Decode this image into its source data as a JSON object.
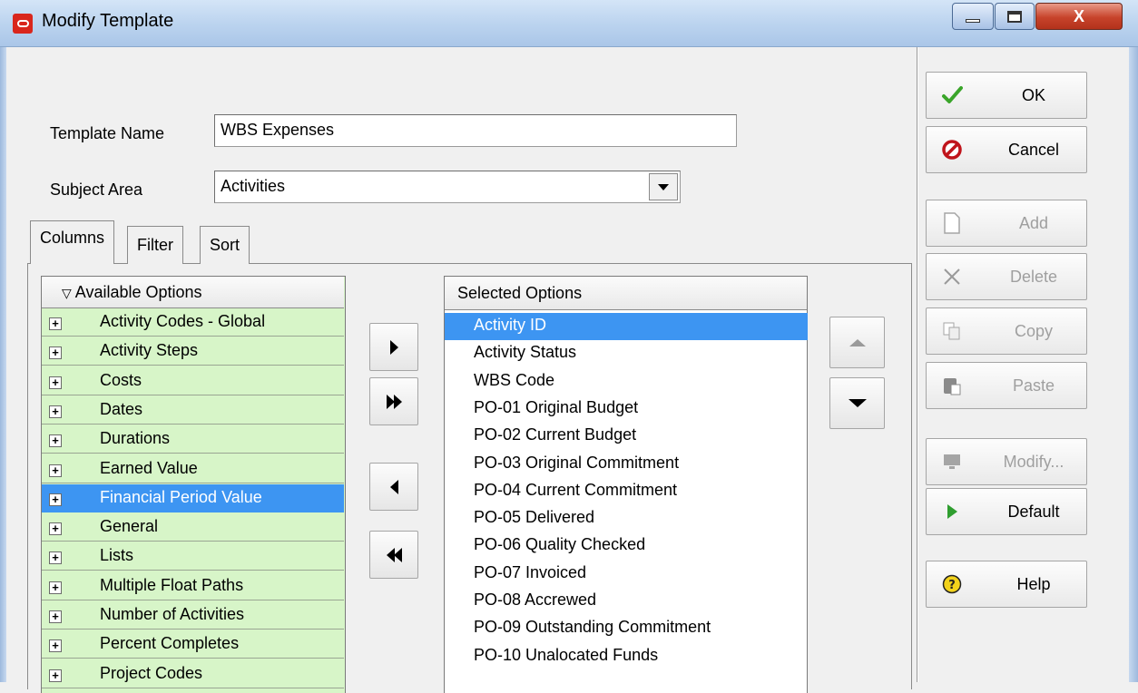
{
  "window": {
    "title": "Modify Template",
    "controls": {
      "close": "X"
    }
  },
  "form": {
    "template_name_label": "Template Name",
    "template_name_value": "WBS Expenses",
    "subject_area_label": "Subject Area",
    "subject_area_value": "Activities"
  },
  "tabs": [
    {
      "label": "Columns",
      "active": true
    },
    {
      "label": "Filter",
      "active": false
    },
    {
      "label": "Sort",
      "active": false
    }
  ],
  "available": {
    "header": "Available Options",
    "header_icon": "sort-down-triangle",
    "expand_glyph": "+",
    "items": [
      {
        "label": "Activity Codes - Global",
        "selected": false
      },
      {
        "label": "Activity Steps",
        "selected": false
      },
      {
        "label": "Costs",
        "selected": false
      },
      {
        "label": "Dates",
        "selected": false
      },
      {
        "label": "Durations",
        "selected": false
      },
      {
        "label": "Earned Value",
        "selected": false
      },
      {
        "label": "Financial Period Value",
        "selected": true
      },
      {
        "label": "General",
        "selected": false
      },
      {
        "label": "Lists",
        "selected": false
      },
      {
        "label": "Multiple Float Paths",
        "selected": false
      },
      {
        "label": "Number of Activities",
        "selected": false
      },
      {
        "label": "Percent Completes",
        "selected": false
      },
      {
        "label": "Project Codes",
        "selected": false
      }
    ]
  },
  "selected": {
    "header": "Selected Options",
    "items": [
      {
        "label": "Activity ID",
        "selected": true
      },
      {
        "label": "Activity Status",
        "selected": false
      },
      {
        "label": "WBS Code",
        "selected": false
      },
      {
        "label": "PO-01 Original Budget",
        "selected": false
      },
      {
        "label": "PO-02 Current Budget",
        "selected": false
      },
      {
        "label": "PO-03 Original Commitment",
        "selected": false
      },
      {
        "label": "PO-04 Current Commitment",
        "selected": false
      },
      {
        "label": "PO-05 Delivered",
        "selected": false
      },
      {
        "label": "PO-06 Quality Checked",
        "selected": false
      },
      {
        "label": "PO-07 Invoiced",
        "selected": false
      },
      {
        "label": "PO-08 Accrewed",
        "selected": false
      },
      {
        "label": "PO-09 Outstanding Commitment",
        "selected": false
      },
      {
        "label": "PO-10 Unalocated Funds",
        "selected": false
      }
    ]
  },
  "side_buttons": {
    "ok": "OK",
    "cancel": "Cancel",
    "add": "Add",
    "delete": "Delete",
    "copy": "Copy",
    "paste": "Paste",
    "modify": "Modify...",
    "default": "Default",
    "help": "Help"
  },
  "colors": {
    "selection": "#3d95f2",
    "available_bg": "#d7f5c8",
    "app_icon": "#d9261c",
    "ok_check": "#3aa52a",
    "cancel_icon": "#c0141b",
    "default_play": "#2f9e2f",
    "help_icon": "#f2d21b"
  }
}
